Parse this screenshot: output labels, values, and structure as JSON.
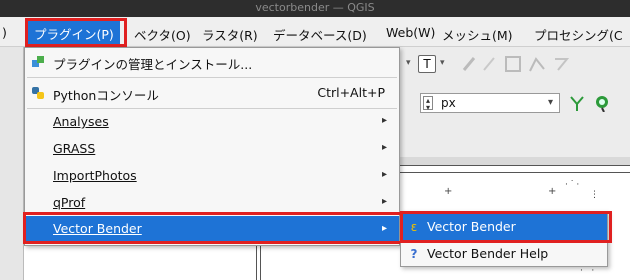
{
  "window": {
    "title": "vectorbender — QGIS"
  },
  "menubar": {
    "items": [
      {
        "label": ")"
      },
      {
        "label": "プラグイン(P)"
      },
      {
        "label": "ベクタ(O)"
      },
      {
        "label": "ラスタ(R)"
      },
      {
        "label": "データベース(D)"
      },
      {
        "label": "Web(W)"
      },
      {
        "label": "メッシュ(M)"
      },
      {
        "label": "プロセシング(C"
      }
    ]
  },
  "toolbar": {
    "unit_value": "px"
  },
  "plugins_menu": {
    "items": [
      {
        "label": "プラグインの管理とインストール...",
        "icon": "puzzle-icon"
      },
      {
        "label": "Pythonコンソール",
        "shortcut": "Ctrl+Alt+P",
        "icon": "python-icon"
      },
      {
        "label": "Analyses"
      },
      {
        "label": "GRASS"
      },
      {
        "label": "ImportPhotos"
      },
      {
        "label": "qProf"
      },
      {
        "label": "Vector Bender"
      }
    ]
  },
  "submenu": {
    "items": [
      {
        "label": "Vector Bender",
        "icon": "vector-bender-icon"
      },
      {
        "label": "Vector Bender Help",
        "icon": "help-icon"
      }
    ]
  },
  "colors": {
    "accent": "#1e73d6",
    "highlight": "#e02020"
  }
}
